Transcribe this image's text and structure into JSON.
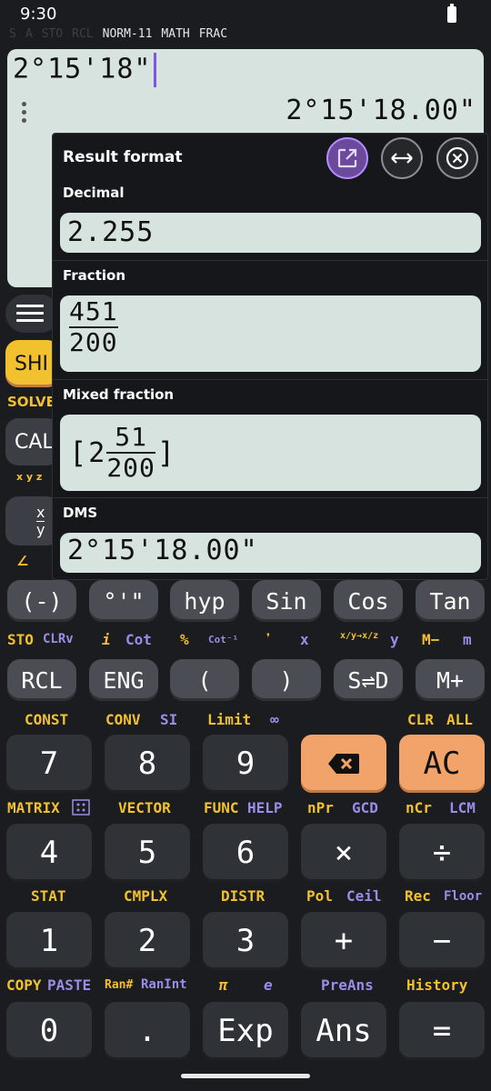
{
  "status": {
    "time": "9:30"
  },
  "indicators": {
    "s": "S",
    "a": "A",
    "sto": "STO",
    "rcl": "RCL",
    "norm": "NORM-11",
    "math": "MATH",
    "frac": "FRAC"
  },
  "display": {
    "expression": "2°15'18\"",
    "result": "2°15'18.00\""
  },
  "background": {
    "shift": "SHI",
    "solve": "SOLVE",
    "calc": "CAL",
    "frac_num": "x",
    "frac_den": "y",
    "xyz": "x y z",
    "angle": "∠"
  },
  "popup": {
    "title": "Result format",
    "decimal_label": "Decimal",
    "decimal_value": "2.255",
    "fraction_label": "Fraction",
    "fraction_num": "451",
    "fraction_den": "200",
    "mixed_label": "Mixed fraction",
    "mixed_open": "[",
    "mixed_whole": "2",
    "mixed_num": "51",
    "mixed_den": "200",
    "mixed_close": "]",
    "dms_label": "DMS",
    "dms_value": "2°15'18.00\""
  },
  "row1": {
    "neg": "(-)",
    "deg": "°'\"",
    "hyp": "hyp",
    "sin": "Sin",
    "cos": "Cos",
    "tan": "Tan"
  },
  "row1_labels": {
    "sto": "STO",
    "clrv": "CLRv",
    "i": "i",
    "cot": "Cot",
    "pct": "%",
    "cot_inv": "Cot⁻¹",
    "comma": "❜",
    "x": "x",
    "xyz": "x/y→x/z",
    "y": "y",
    "mminus": "M−",
    "m": "m"
  },
  "row2": {
    "rcl": "RCL",
    "eng": "ENG",
    "lparen": "(",
    "rparen": ")",
    "sd": "S⇌D",
    "mplus": "M+"
  },
  "row2_labels": {
    "const": "CONST",
    "conv": "CONV",
    "si": "SI",
    "limit": "Limit",
    "inf": "∞",
    "clr": "CLR",
    "all": "ALL"
  },
  "row3": {
    "k7": "7",
    "k8": "8",
    "k9": "9",
    "del": "⌫",
    "ac": "AC"
  },
  "row3_labels": {
    "matrix": "MATRIX",
    "vector": "VECTOR",
    "func": "FUNC",
    "help": "HELP",
    "npr": "nPr",
    "gcd": "GCD",
    "ncr": "nCr",
    "lcm": "LCM"
  },
  "row4": {
    "k4": "4",
    "k5": "5",
    "k6": "6",
    "mul": "×",
    "div": "÷"
  },
  "row4_labels": {
    "stat": "STAT",
    "cmplx": "CMPLX",
    "distr": "DISTR",
    "pol": "Pol",
    "ceil": "Ceil",
    "rec": "Rec",
    "floor": "Floor"
  },
  "row5": {
    "k1": "1",
    "k2": "2",
    "k3": "3",
    "plus": "+",
    "minus": "−"
  },
  "row5_labels": {
    "copy": "COPY",
    "paste": "PASTE",
    "ran": "Ran#",
    "ranint": "RanInt",
    "pi": "π",
    "e": "e",
    "preans": "PreAns",
    "history": "History"
  },
  "row6": {
    "k0": "0",
    "dot": ".",
    "exp": "Exp",
    "ans": "Ans",
    "eq": "="
  },
  "colors": {
    "accent": "#f2a36a",
    "display_bg": "#d6e3de",
    "shift_label": "#f2c12e",
    "alpha_label": "#9a8ce8",
    "cursor": "#7d55e8"
  }
}
